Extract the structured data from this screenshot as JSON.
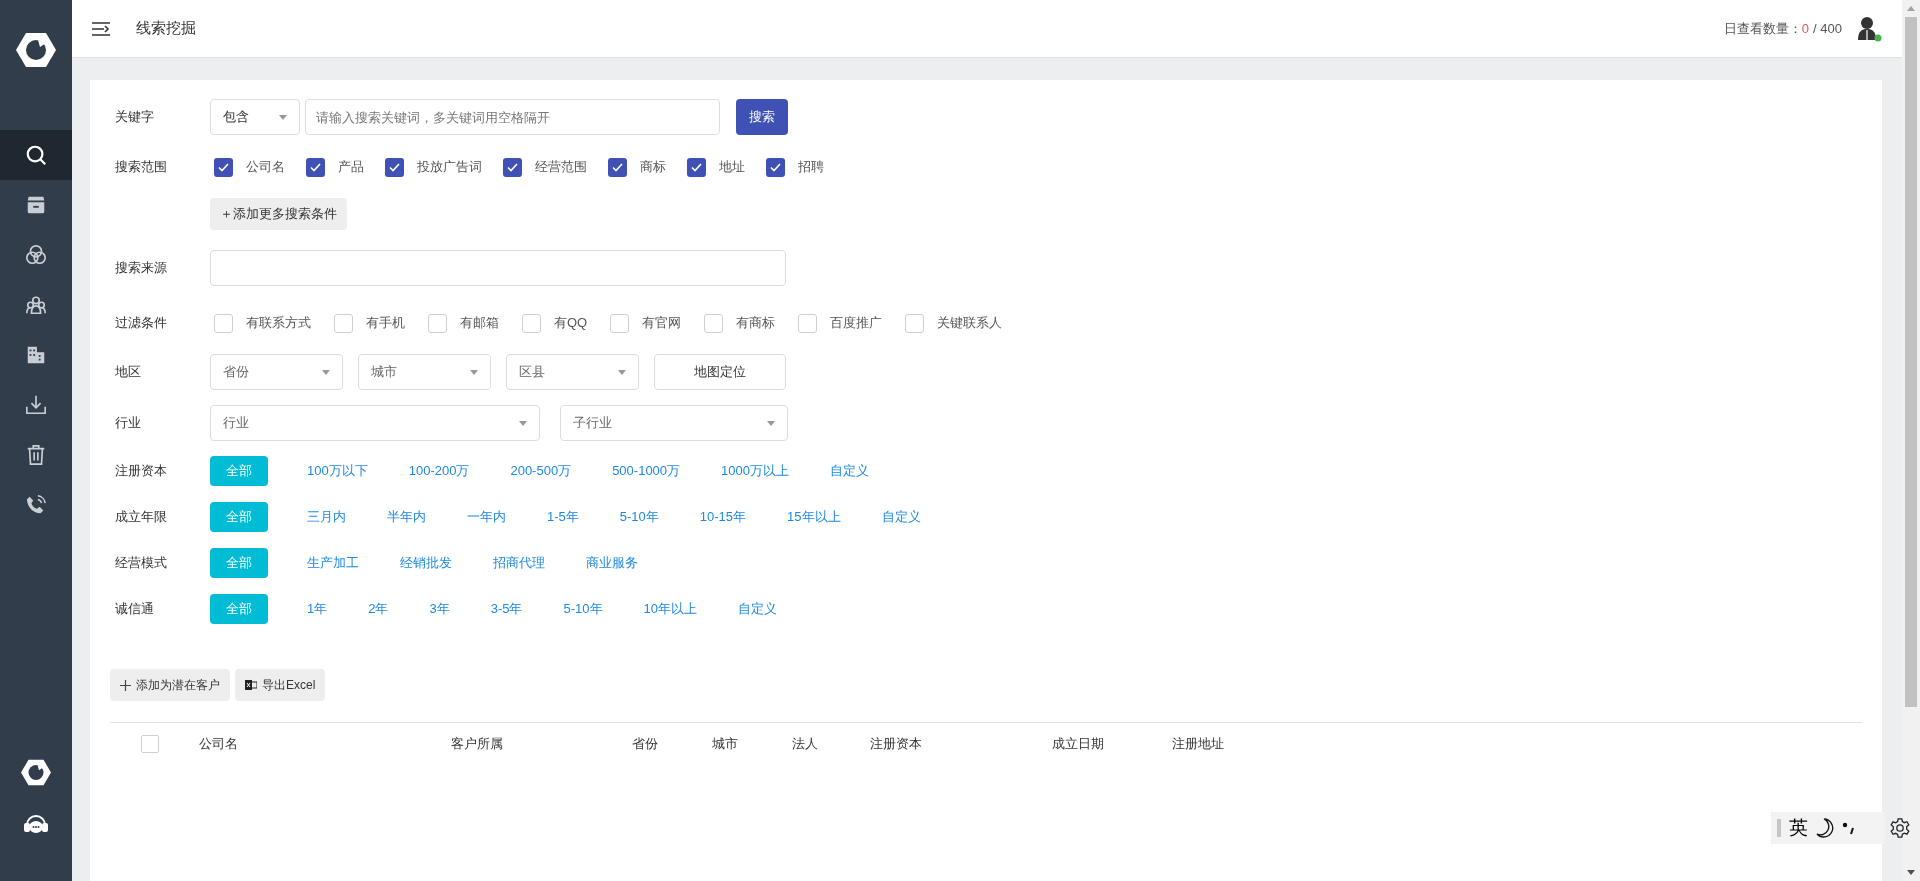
{
  "sidebar": {
    "items": [
      {
        "kind": "search",
        "selected": true
      },
      {
        "kind": "archive",
        "selected": false
      },
      {
        "kind": "rings",
        "selected": false
      },
      {
        "kind": "people",
        "selected": false
      },
      {
        "kind": "building",
        "selected": false
      },
      {
        "kind": "download",
        "selected": false
      },
      {
        "kind": "trash",
        "selected": false
      },
      {
        "kind": "phone",
        "selected": false
      }
    ]
  },
  "header": {
    "title": "线索挖掘",
    "quota_label": "日查看数量：",
    "quota_used": "0",
    "quota_rest": "/ 400",
    "user_online": true
  },
  "form": {
    "keyword": {
      "label": "关键字",
      "mode": "包含",
      "placeholder": "请输入搜索关键词，多关键词用空格隔开",
      "button": "搜索"
    },
    "scope": {
      "label": "搜索范围",
      "options": [
        {
          "label": "公司名",
          "checked": true
        },
        {
          "label": "产品",
          "checked": true
        },
        {
          "label": "投放广告词",
          "checked": true
        },
        {
          "label": "经营范围",
          "checked": true
        },
        {
          "label": "商标",
          "checked": true
        },
        {
          "label": "地址",
          "checked": true
        },
        {
          "label": "招聘",
          "checked": true
        }
      ],
      "add_button": "＋添加更多搜索条件"
    },
    "source": {
      "label": "搜索来源"
    },
    "filters": {
      "label": "过滤条件",
      "options": [
        {
          "label": "有联系方式",
          "checked": false
        },
        {
          "label": "有手机",
          "checked": false
        },
        {
          "label": "有邮箱",
          "checked": false
        },
        {
          "label": "有QQ",
          "checked": false
        },
        {
          "label": "有官网",
          "checked": false
        },
        {
          "label": "有商标",
          "checked": false
        },
        {
          "label": "百度推广",
          "checked": false
        },
        {
          "label": "关键联系人",
          "checked": false
        }
      ]
    },
    "region": {
      "label": "地区",
      "selects": [
        {
          "placeholder": "省份"
        },
        {
          "placeholder": "城市"
        },
        {
          "placeholder": "区县"
        }
      ],
      "map_button": "地图定位"
    },
    "industry": {
      "label": "行业",
      "selects": [
        {
          "placeholder": "行业"
        },
        {
          "placeholder": "子行业"
        }
      ]
    },
    "choice_rows": [
      {
        "label": "注册资本",
        "options": [
          {
            "label": "全部",
            "selected": true
          },
          {
            "label": "100万以下",
            "selected": false
          },
          {
            "label": "100-200万",
            "selected": false
          },
          {
            "label": "200-500万",
            "selected": false
          },
          {
            "label": "500-1000万",
            "selected": false
          },
          {
            "label": "1000万以上",
            "selected": false
          },
          {
            "label": "自定义",
            "selected": false
          }
        ]
      },
      {
        "label": "成立年限",
        "options": [
          {
            "label": "全部",
            "selected": true
          },
          {
            "label": "三月内",
            "selected": false
          },
          {
            "label": "半年内",
            "selected": false
          },
          {
            "label": "一年内",
            "selected": false
          },
          {
            "label": "1-5年",
            "selected": false
          },
          {
            "label": "5-10年",
            "selected": false
          },
          {
            "label": "10-15年",
            "selected": false
          },
          {
            "label": "15年以上",
            "selected": false
          },
          {
            "label": "自定义",
            "selected": false
          }
        ]
      },
      {
        "label": "经营模式",
        "options": [
          {
            "label": "全部",
            "selected": true
          },
          {
            "label": "生产加工",
            "selected": false
          },
          {
            "label": "经销批发",
            "selected": false
          },
          {
            "label": "招商代理",
            "selected": false
          },
          {
            "label": "商业服务",
            "selected": false
          }
        ]
      },
      {
        "label": "诚信通",
        "options": [
          {
            "label": "全部",
            "selected": true
          },
          {
            "label": "1年",
            "selected": false
          },
          {
            "label": "2年",
            "selected": false
          },
          {
            "label": "3年",
            "selected": false
          },
          {
            "label": "3-5年",
            "selected": false
          },
          {
            "label": "5-10年",
            "selected": false
          },
          {
            "label": "10年以上",
            "selected": false
          },
          {
            "label": "自定义",
            "selected": false
          }
        ]
      }
    ]
  },
  "actions": [
    {
      "kind": "add",
      "label": "添加为潜在客户"
    },
    {
      "kind": "excel",
      "label": "导出Excel"
    }
  ],
  "table": {
    "select_all": false,
    "columns": [
      "公司名",
      "客户所属",
      "省份",
      "城市",
      "法人",
      "注册资本",
      "成立日期",
      "注册地址"
    ]
  },
  "ime": {
    "language": "英"
  }
}
